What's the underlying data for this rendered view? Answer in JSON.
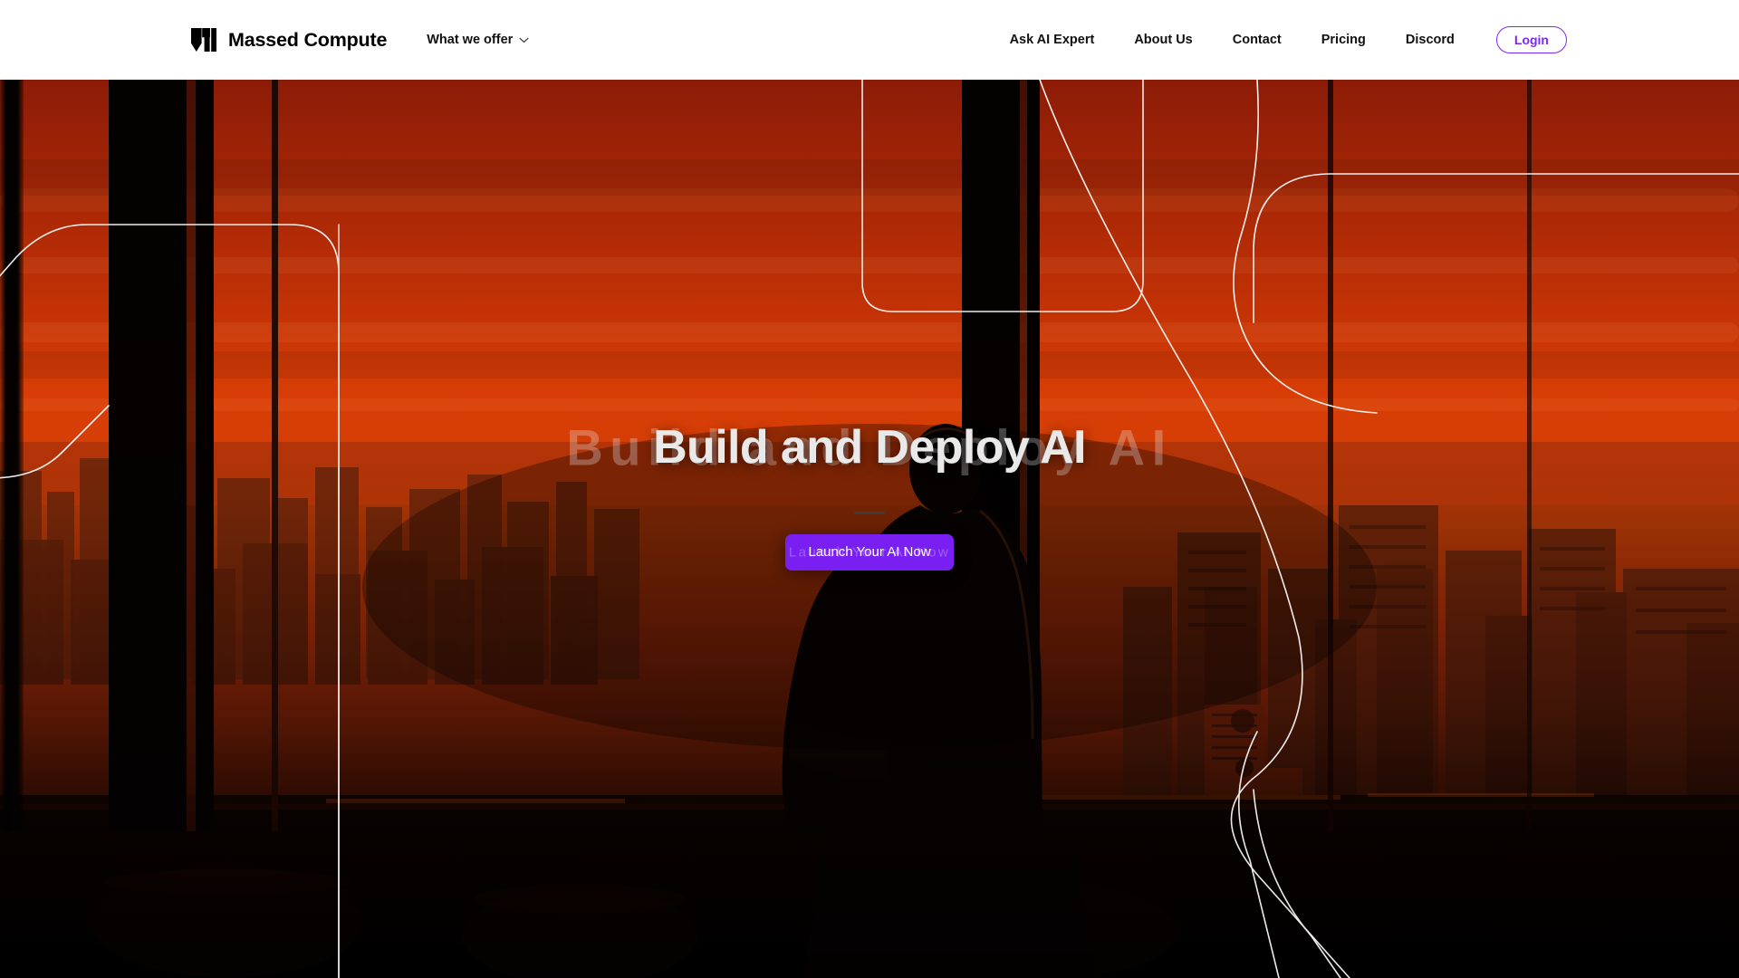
{
  "header": {
    "logo_icon": "massed-compute-m-logo",
    "brand_name": "Massed Compute",
    "offer_menu": {
      "label": "What we offer",
      "icon": "chevron-down-icon"
    },
    "nav_links": [
      {
        "label": "Ask AI Expert"
      },
      {
        "label": "About Us"
      },
      {
        "label": "Contact"
      },
      {
        "label": "Pricing"
      },
      {
        "label": "Discord"
      }
    ],
    "login_label": "Login",
    "background": "#ffffff",
    "accent": "#7a28f5"
  },
  "hero": {
    "headline": "Build and Deploy AI",
    "headline_ghost": "Build and Deploy AI",
    "cta_label": "Launch Your AI Now",
    "cta_ghost_label": "Launch Your AI Now",
    "cta_color": "#7a1ff2",
    "image_description": "Silhouette of a person with a backpack standing at a floor-to-ceiling window overlooking an orange-tinted city skyline at sunset",
    "overlay_tint": "#cc2c05"
  }
}
